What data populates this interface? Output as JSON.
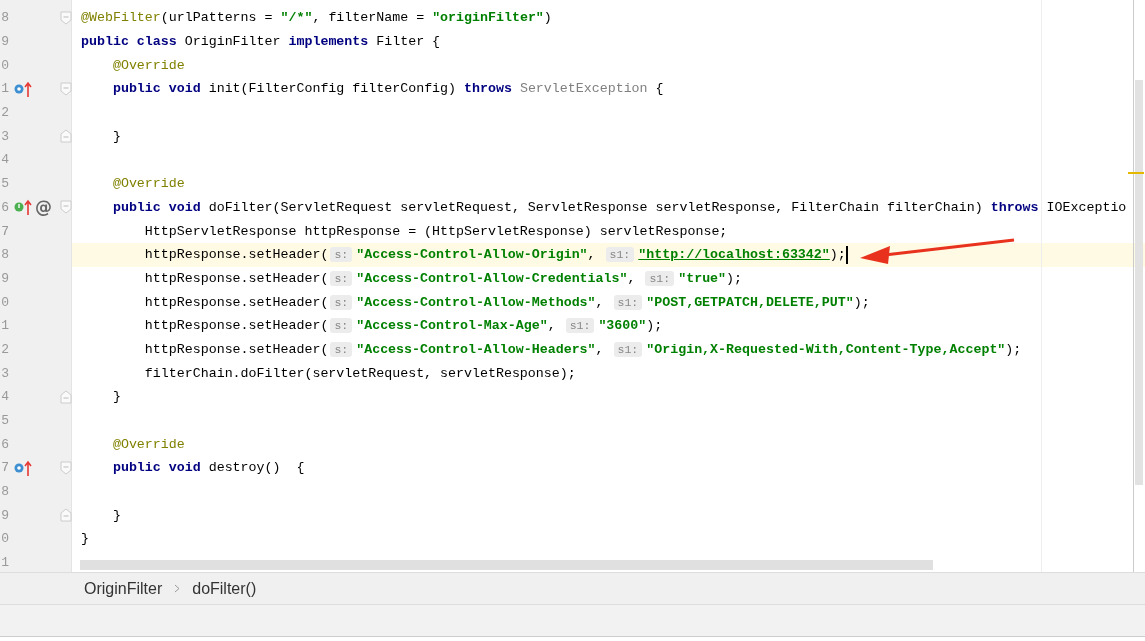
{
  "editor": {
    "lines": [
      {
        "number": "8",
        "fold": {
          "kind": "start"
        },
        "highlighted": false,
        "tokens": [
          {
            "kind": "ann",
            "text": "@WebFilter"
          },
          {
            "kind": "plain",
            "text": "(urlPatterns = "
          },
          {
            "kind": "str",
            "text": "\"/*\""
          },
          {
            "kind": "plain",
            "text": ", filterName = "
          },
          {
            "kind": "str",
            "text": "\"originFilter\""
          },
          {
            "kind": "plain",
            "text": ")"
          }
        ]
      },
      {
        "number": "9",
        "highlighted": false,
        "tokens": [
          {
            "kind": "kw",
            "text": "public class"
          },
          {
            "kind": "plain",
            "text": " OriginFilter "
          },
          {
            "kind": "kw",
            "text": "implements"
          },
          {
            "kind": "plain",
            "text": " Filter {"
          }
        ]
      },
      {
        "number": "0",
        "highlighted": false,
        "tokens": [
          {
            "kind": "ann",
            "text": "    @Override"
          }
        ]
      },
      {
        "number": "1",
        "fold": {
          "kind": "start"
        },
        "gutter": [
          {
            "kind": "override",
            "color": "#3d8fd1"
          }
        ],
        "highlighted": false,
        "tokens": [
          {
            "kind": "kw",
            "text": "    public void"
          },
          {
            "kind": "plain",
            "text": " init(FilterConfig filterConfig) "
          },
          {
            "kind": "kw",
            "text": "throws"
          },
          {
            "kind": "gray",
            "text": " ServletException"
          },
          {
            "kind": "plain",
            "text": " {"
          }
        ]
      },
      {
        "number": "2",
        "highlighted": false
      },
      {
        "number": "3",
        "fold": {
          "kind": "end"
        },
        "highlighted": false,
        "tokens": [
          {
            "kind": "plain",
            "text": "    }"
          }
        ]
      },
      {
        "number": "4",
        "highlighted": false
      },
      {
        "number": "5",
        "highlighted": false,
        "tokens": [
          {
            "kind": "ann",
            "text": "    @Override"
          }
        ]
      },
      {
        "number": "6",
        "fold": {
          "kind": "start"
        },
        "gutter": [
          {
            "kind": "implement",
            "color": "#4caf50"
          },
          {
            "kind": "at",
            "text": "@"
          }
        ],
        "highlighted": false,
        "tokens": [
          {
            "kind": "kw",
            "text": "    public void"
          },
          {
            "kind": "plain",
            "text": " doFilter(ServletRequest servletRequest, ServletResponse servletResponse, FilterChain filterChain) "
          },
          {
            "kind": "kw",
            "text": "throws"
          },
          {
            "kind": "plain",
            "text": " IOExceptio"
          }
        ]
      },
      {
        "number": "7",
        "highlighted": false,
        "tokens": [
          {
            "kind": "plain",
            "text": "        HttpServletResponse httpResponse = (HttpServletResponse) servletResponse;"
          }
        ]
      },
      {
        "number": "8",
        "highlighted": true,
        "tokens": [
          {
            "kind": "plain",
            "text": "        httpResponse.setHeader("
          },
          {
            "kind": "hint",
            "text": "s:"
          },
          {
            "kind": "str",
            "text": "\"Access-Control-Allow-Origin\""
          },
          {
            "kind": "plain",
            "text": ", "
          },
          {
            "kind": "hint",
            "text": "s1:"
          },
          {
            "kind": "url",
            "text": "\"http://localhost:63342\""
          },
          {
            "kind": "plain",
            "text": ");"
          }
        ]
      },
      {
        "number": "9",
        "highlighted": false,
        "tokens": [
          {
            "kind": "plain",
            "text": "        httpResponse.setHeader("
          },
          {
            "kind": "hint",
            "text": "s:"
          },
          {
            "kind": "str",
            "text": "\"Access-Control-Allow-Credentials\""
          },
          {
            "kind": "plain",
            "text": ", "
          },
          {
            "kind": "hint",
            "text": "s1:"
          },
          {
            "kind": "str",
            "text": "\"true\""
          },
          {
            "kind": "plain",
            "text": ");"
          }
        ]
      },
      {
        "number": "0",
        "highlighted": false,
        "tokens": [
          {
            "kind": "plain",
            "text": "        httpResponse.setHeader("
          },
          {
            "kind": "hint",
            "text": "s:"
          },
          {
            "kind": "str",
            "text": "\"Access-Control-Allow-Methods\""
          },
          {
            "kind": "plain",
            "text": ", "
          },
          {
            "kind": "hint",
            "text": "s1:"
          },
          {
            "kind": "str",
            "text": "\"POST,GETPATCH,DELETE,PUT\""
          },
          {
            "kind": "plain",
            "text": ");"
          }
        ]
      },
      {
        "number": "1",
        "highlighted": false,
        "tokens": [
          {
            "kind": "plain",
            "text": "        httpResponse.setHeader("
          },
          {
            "kind": "hint",
            "text": "s:"
          },
          {
            "kind": "str",
            "text": "\"Access-Control-Max-Age\""
          },
          {
            "kind": "plain",
            "text": ", "
          },
          {
            "kind": "hint",
            "text": "s1:"
          },
          {
            "kind": "str",
            "text": "\"3600\""
          },
          {
            "kind": "plain",
            "text": ");"
          }
        ]
      },
      {
        "number": "2",
        "highlighted": false,
        "tokens": [
          {
            "kind": "plain",
            "text": "        httpResponse.setHeader("
          },
          {
            "kind": "hint",
            "text": "s:"
          },
          {
            "kind": "str",
            "text": "\"Access-Control-Allow-Headers\""
          },
          {
            "kind": "plain",
            "text": ", "
          },
          {
            "kind": "hint",
            "text": "s1:"
          },
          {
            "kind": "str",
            "text": "\"Origin,X-Requested-With,Content-Type,Accept\""
          },
          {
            "kind": "plain",
            "text": ");"
          }
        ]
      },
      {
        "number": "3",
        "highlighted": false,
        "tokens": [
          {
            "kind": "plain",
            "text": "        filterChain.doFilter(servletRequest, servletResponse);"
          }
        ]
      },
      {
        "number": "4",
        "fold": {
          "kind": "end"
        },
        "highlighted": false,
        "tokens": [
          {
            "kind": "plain",
            "text": "    }"
          }
        ]
      },
      {
        "number": "5",
        "highlighted": false
      },
      {
        "number": "6",
        "highlighted": false,
        "tokens": [
          {
            "kind": "ann",
            "text": "    @Override"
          }
        ]
      },
      {
        "number": "7",
        "fold": {
          "kind": "start"
        },
        "gutter": [
          {
            "kind": "override",
            "color": "#3d8fd1"
          }
        ],
        "highlighted": false,
        "tokens": [
          {
            "kind": "kw",
            "text": "    public void"
          },
          {
            "kind": "plain",
            "text": " destroy()  {"
          }
        ]
      },
      {
        "number": "8",
        "highlighted": false
      },
      {
        "number": "9",
        "fold": {
          "kind": "end"
        },
        "highlighted": false,
        "tokens": [
          {
            "kind": "plain",
            "text": "    }"
          }
        ]
      },
      {
        "number": "0",
        "highlighted": false,
        "tokens": [
          {
            "kind": "plain",
            "text": "}"
          }
        ]
      },
      {
        "number": "1",
        "highlighted": false
      }
    ]
  },
  "breadcrumbs": [
    {
      "text": "OriginFilter"
    },
    {
      "text": "doFilter()"
    }
  ]
}
